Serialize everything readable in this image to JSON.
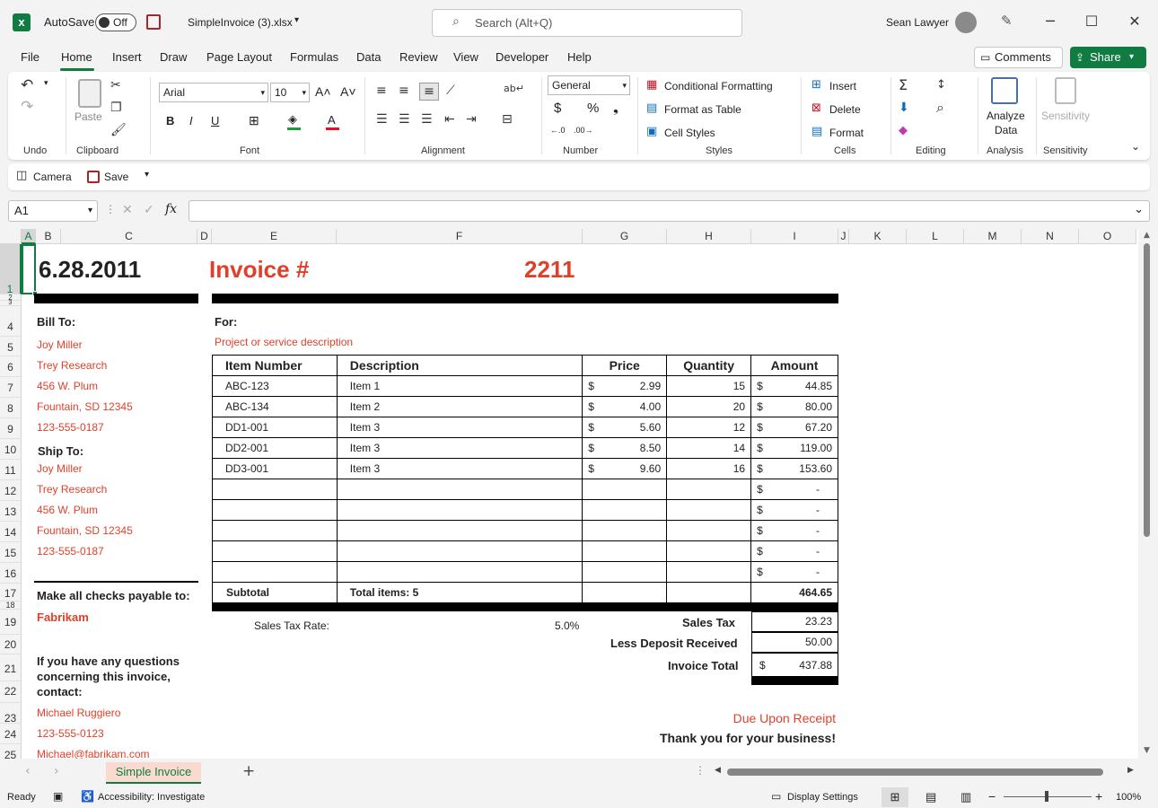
{
  "title_bar": {
    "autosave_label": "AutoSave",
    "autosave_state": "Off",
    "filename": "SimpleInvoice (3).xlsx",
    "search_placeholder": "Search (Alt+Q)",
    "user_name": "Sean Lawyer"
  },
  "tabs": [
    "File",
    "Home",
    "Insert",
    "Draw",
    "Page Layout",
    "Formulas",
    "Data",
    "Review",
    "View",
    "Developer",
    "Help"
  ],
  "active_tab": "Home",
  "header_buttons": {
    "comments": "Comments",
    "share": "Share"
  },
  "ribbon": {
    "groups": {
      "undo": "Undo",
      "clipboard": "Clipboard",
      "font": "Font",
      "alignment": "Alignment",
      "number": "Number",
      "styles": "Styles",
      "cells": "Cells",
      "editing": "Editing",
      "analysis": "Analysis",
      "sensitivity": "Sensitivity"
    },
    "paste_label": "Paste",
    "font_name": "Arial",
    "font_size": "10",
    "number_format": "General",
    "styles_items": [
      "Conditional Formatting",
      "Format as Table",
      "Cell Styles"
    ],
    "cells_items": [
      "Insert",
      "Delete",
      "Format"
    ],
    "analyze_label_1": "Analyze",
    "analyze_label_2": "Data",
    "sensitivity_label": "Sensitivity"
  },
  "qat": {
    "camera": "Camera",
    "save": "Save"
  },
  "formula_bar": {
    "name_box": "A1",
    "formula": ""
  },
  "columns": [
    "A",
    "B",
    "C",
    "D",
    "E",
    "F",
    "G",
    "H",
    "I",
    "J",
    "K",
    "L",
    "M",
    "N",
    "O"
  ],
  "rows": [
    "1",
    "2",
    "3",
    "4",
    "5",
    "6",
    "7",
    "8",
    "9",
    "10",
    "11",
    "12",
    "13",
    "14",
    "15",
    "16",
    "17",
    "18",
    "19",
    "20",
    "21",
    "22",
    "23",
    "24",
    "25"
  ],
  "invoice": {
    "date": "6.28.2011",
    "invoice_label": "Invoice #",
    "invoice_number": "2211",
    "bill_to_label": "Bill To:",
    "bill_to": [
      "Joy Miller",
      "Trey Research",
      "456 W. Plum",
      "Fountain, SD 12345",
      "123-555-0187"
    ],
    "ship_to_label": "Ship To:",
    "ship_to": [
      "Joy Miller",
      "Trey Research",
      "456 W. Plum",
      "Fountain, SD 12345",
      "123-555-0187"
    ],
    "for_label": "For:",
    "project_description": "Project or service description",
    "table_headers": [
      "Item Number",
      "Description",
      "Price",
      "Quantity",
      "Amount"
    ],
    "items": [
      {
        "num": "ABC-123",
        "desc": "Item 1",
        "price": "2.99",
        "qty": "15",
        "amount": "44.85"
      },
      {
        "num": "ABC-134",
        "desc": "Item 2",
        "price": "4.00",
        "qty": "20",
        "amount": "80.00"
      },
      {
        "num": "DD1-001",
        "desc": "Item 3",
        "price": "5.60",
        "qty": "12",
        "amount": "67.20"
      },
      {
        "num": "DD2-001",
        "desc": "Item 3",
        "price": "8.50",
        "qty": "14",
        "amount": "119.00"
      },
      {
        "num": "DD3-001",
        "desc": "Item 3",
        "price": "9.60",
        "qty": "16",
        "amount": "153.60"
      },
      {
        "num": "",
        "desc": "",
        "price": "",
        "qty": "",
        "amount": "-"
      },
      {
        "num": "",
        "desc": "",
        "price": "",
        "qty": "",
        "amount": "-"
      },
      {
        "num": "",
        "desc": "",
        "price": "",
        "qty": "",
        "amount": "-"
      },
      {
        "num": "",
        "desc": "",
        "price": "",
        "qty": "",
        "amount": "-"
      },
      {
        "num": "",
        "desc": "",
        "price": "",
        "qty": "",
        "amount": "-"
      }
    ],
    "currency": "$",
    "subtotal_label": "Subtotal",
    "total_items": "Total items: 5",
    "subtotal": "464.65",
    "sales_tax_rate_label": "Sales  Tax Rate:",
    "sales_tax_rate": "5.0%",
    "sales_tax_label": "Sales Tax",
    "sales_tax": "23.23",
    "deposit_label": "Less Deposit Received",
    "deposit": "50.00",
    "invoice_total_label": "Invoice Total",
    "invoice_total": "437.88",
    "checks_label": "Make all checks payable to:",
    "payee": "Fabrikam",
    "questions_1": "If you have any questions",
    "questions_2": "concerning this invoice,",
    "questions_3": "contact:",
    "contact_name": "Michael Ruggiero",
    "contact_phone": "123-555-0123",
    "contact_email": "Michael@fabrikam.com",
    "due": "Due Upon Receipt",
    "thanks": "Thank you for your business!"
  },
  "sheet_tab": "Simple Invoice",
  "status": {
    "ready": "Ready",
    "accessibility": "Accessibility: Investigate",
    "display_settings": "Display Settings",
    "zoom": "100%"
  }
}
